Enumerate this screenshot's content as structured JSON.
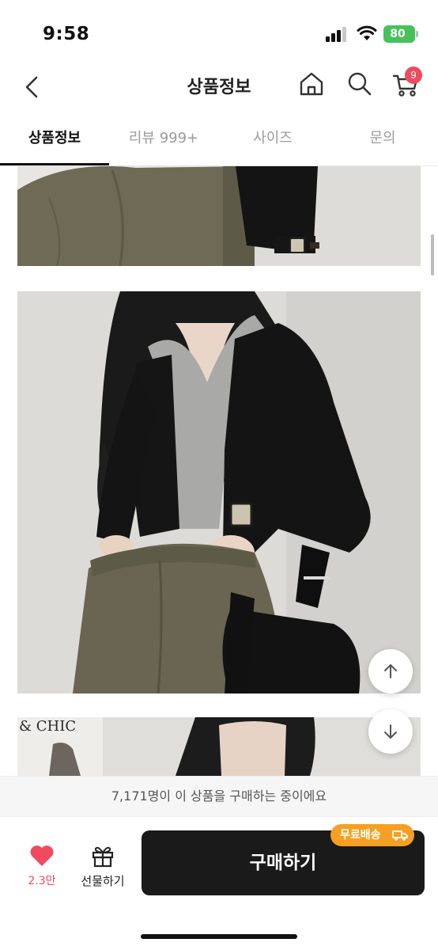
{
  "status_bar": {
    "time": "9:58",
    "battery": "80",
    "battery_color": "#45c25a"
  },
  "header": {
    "title": "상품정보",
    "back_icon": "chevron-left-icon",
    "home_icon": "home-icon",
    "search_icon": "search-icon",
    "cart_icon": "cart-icon",
    "cart_count": "9",
    "badge_color": "#f04a5d"
  },
  "tabs": [
    {
      "label": "상품정보",
      "active": true
    },
    {
      "label": "리뷰 999+",
      "active": false
    },
    {
      "label": "사이즈",
      "active": false
    },
    {
      "label": "문의",
      "active": false
    }
  ],
  "content": {
    "magazine_text": "& CHIC",
    "scroll_up_icon": "arrow-up-icon",
    "scroll_down_icon": "arrow-down-icon"
  },
  "buyer_notice": "7,171명이 이 상품을 구매하는 중이에요",
  "action_bar": {
    "like_icon": "heart-icon",
    "like_count": "2.3만",
    "like_color": "#ef4a5e",
    "gift_icon": "gift-icon",
    "gift_label": "선물하기",
    "buy_label": "구매하기",
    "free_shipping_label": "무료배송",
    "free_shipping_icon": "truck-icon",
    "free_shipping_color": "#f5a023"
  }
}
